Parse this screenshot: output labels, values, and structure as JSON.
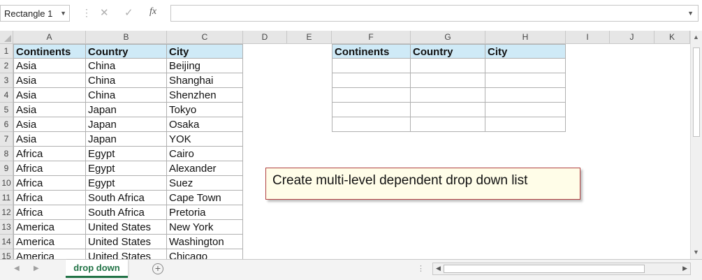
{
  "formula_bar": {
    "name_box": "Rectangle 1",
    "formula": "",
    "separator_glyph": "⋮",
    "cancel_glyph": "✕",
    "enter_glyph": "✓",
    "fx_label": "fx",
    "dropdown_glyph": "▼"
  },
  "columns": [
    "A",
    "B",
    "C",
    "D",
    "E",
    "F",
    "G",
    "H",
    "I",
    "J",
    "K"
  ],
  "rows": [
    "1",
    "2",
    "3",
    "4",
    "5",
    "6",
    "7",
    "8",
    "9",
    "10",
    "11",
    "12",
    "13",
    "14",
    "15"
  ],
  "source_table": {
    "headers": [
      "Continents",
      "Country",
      "City"
    ],
    "rows": [
      [
        "Asia",
        "China",
        "Beijing"
      ],
      [
        "Asia",
        "China",
        "Shanghai"
      ],
      [
        "Asia",
        "China",
        "Shenzhen"
      ],
      [
        "Asia",
        "Japan",
        "Tokyo"
      ],
      [
        "Asia",
        "Japan",
        "Osaka"
      ],
      [
        "Asia",
        "Japan",
        "YOK"
      ],
      [
        "Africa",
        "Egypt",
        "Cairo"
      ],
      [
        "Africa",
        "Egypt",
        "Alexander"
      ],
      [
        "Africa",
        "Egypt",
        "Suez"
      ],
      [
        "Africa",
        "South Africa",
        "Cape Town"
      ],
      [
        "Africa",
        "South Africa",
        "Pretoria"
      ],
      [
        "America",
        "United States",
        "New York"
      ],
      [
        "America",
        "United States",
        "Washington"
      ],
      [
        "America",
        "United States",
        "Chicago"
      ]
    ]
  },
  "target_table": {
    "headers": [
      "Continents",
      "Country",
      "City"
    ],
    "rows": [
      [
        "",
        "",
        ""
      ],
      [
        "",
        "",
        ""
      ],
      [
        "",
        "",
        ""
      ],
      [
        "",
        "",
        ""
      ],
      [
        "",
        "",
        ""
      ]
    ]
  },
  "callout": {
    "text": "Create multi-level dependent drop down list"
  },
  "sheet_tabs": {
    "active": "drop down",
    "add_glyph": "+"
  },
  "scrollbars": {
    "up": "▲",
    "down": "▼",
    "left": "◀",
    "right": "▶",
    "nav_prev": "◀",
    "nav_next": "▶",
    "dots": "⋮"
  },
  "colors": {
    "header_fill": "#cfeaf7",
    "tab_accent": "#217346",
    "callout_fill": "#fffde8",
    "callout_border": "#b04040"
  }
}
